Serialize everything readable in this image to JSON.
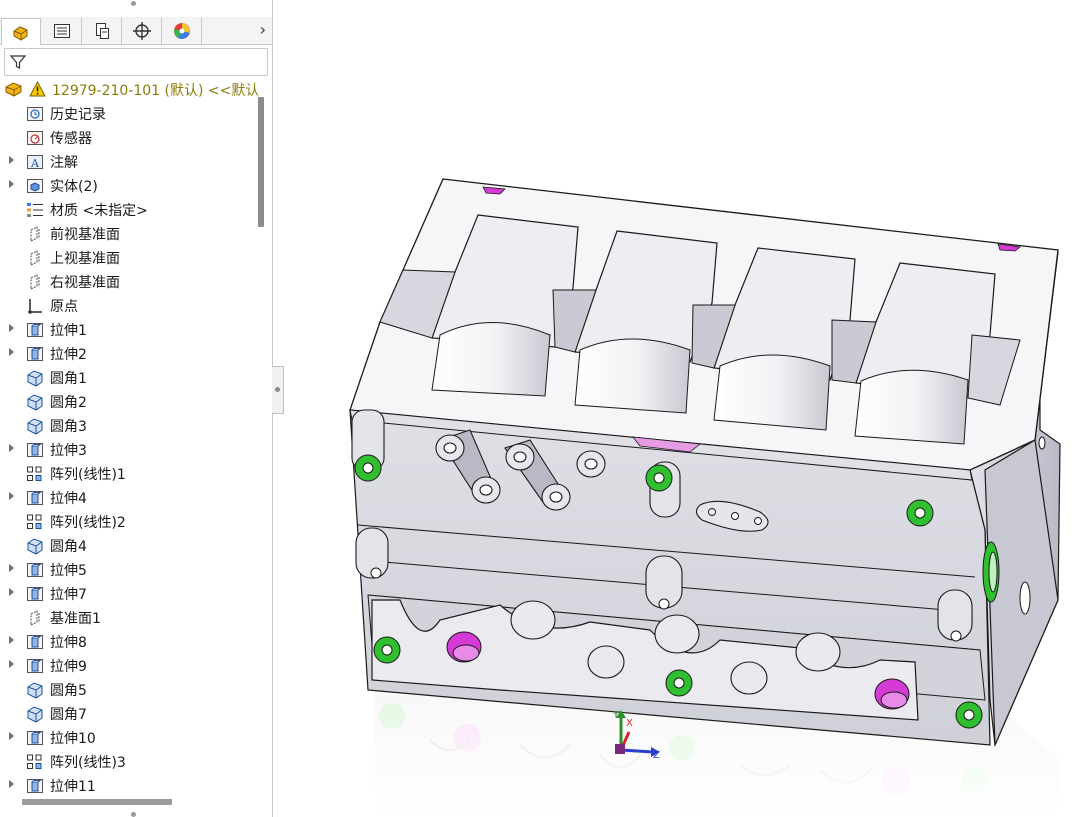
{
  "panel": {
    "tabs": [
      {
        "icon": "feature-manager-icon",
        "active": true
      },
      {
        "icon": "property-manager-icon",
        "active": false
      },
      {
        "icon": "configuration-manager-icon",
        "active": false
      },
      {
        "icon": "dimxpert-icon",
        "active": false
      },
      {
        "icon": "display-manager-icon",
        "active": false
      }
    ],
    "more_glyph": "›",
    "filter_icon": "funnel-icon",
    "root": {
      "label": "12979-210-101 (默认) <<默认",
      "icon": "part-icon",
      "warning_icon": "warning-icon"
    },
    "tree": [
      {
        "label": "历史记录",
        "icon": "history-icon",
        "expandable": false
      },
      {
        "label": "传感器",
        "icon": "sensor-icon",
        "expandable": false
      },
      {
        "label": "注解",
        "icon": "annotation-icon",
        "expandable": true
      },
      {
        "label": "实体(2)",
        "icon": "solid-bodies-icon",
        "expandable": true
      },
      {
        "label": "材质 <未指定>",
        "icon": "material-icon",
        "expandable": false
      },
      {
        "label": "前视基准面",
        "icon": "plane-icon",
        "expandable": false
      },
      {
        "label": "上视基准面",
        "icon": "plane-icon",
        "expandable": false
      },
      {
        "label": "右视基准面",
        "icon": "plane-icon",
        "expandable": false
      },
      {
        "label": "原点",
        "icon": "origin-icon",
        "expandable": false
      },
      {
        "label": "拉伸1",
        "icon": "extrude-icon",
        "expandable": true
      },
      {
        "label": "拉伸2",
        "icon": "extrude-icon",
        "expandable": true
      },
      {
        "label": "圆角1",
        "icon": "fillet-icon",
        "expandable": false
      },
      {
        "label": "圆角2",
        "icon": "fillet-icon",
        "expandable": false
      },
      {
        "label": "圆角3",
        "icon": "fillet-icon",
        "expandable": false
      },
      {
        "label": "拉伸3",
        "icon": "extrude-icon",
        "expandable": true
      },
      {
        "label": "阵列(线性)1",
        "icon": "linear-pattern-icon",
        "expandable": false
      },
      {
        "label": "拉伸4",
        "icon": "extrude-icon",
        "expandable": true
      },
      {
        "label": "阵列(线性)2",
        "icon": "linear-pattern-icon",
        "expandable": false
      },
      {
        "label": "圆角4",
        "icon": "fillet-icon",
        "expandable": false
      },
      {
        "label": "拉伸5",
        "icon": "extrude-icon",
        "expandable": true
      },
      {
        "label": "拉伸7",
        "icon": "extrude-icon",
        "expandable": true
      },
      {
        "label": "基准面1",
        "icon": "plane-icon",
        "expandable": false
      },
      {
        "label": "拉伸8",
        "icon": "extrude-icon",
        "expandable": true
      },
      {
        "label": "拉伸9",
        "icon": "extrude-icon",
        "expandable": true
      },
      {
        "label": "圆角5",
        "icon": "fillet-icon",
        "expandable": false
      },
      {
        "label": "圆角7",
        "icon": "fillet-icon",
        "expandable": false
      },
      {
        "label": "拉伸10",
        "icon": "extrude-icon",
        "expandable": true
      },
      {
        "label": "阵列(线性)3",
        "icon": "linear-pattern-icon",
        "expandable": false
      },
      {
        "label": "拉伸11",
        "icon": "extrude-icon",
        "expandable": true
      }
    ]
  },
  "triad": {
    "y_label": "Y",
    "x_label": "X",
    "z_label": "Z"
  },
  "colors": {
    "root_text": "#8c7d0a",
    "hole_green": "#2fbf2f",
    "hole_magenta": "#d63ad6",
    "model_face": "#f4f4f6",
    "model_shade": "#c9cad3",
    "edge": "#1a1a1a"
  }
}
